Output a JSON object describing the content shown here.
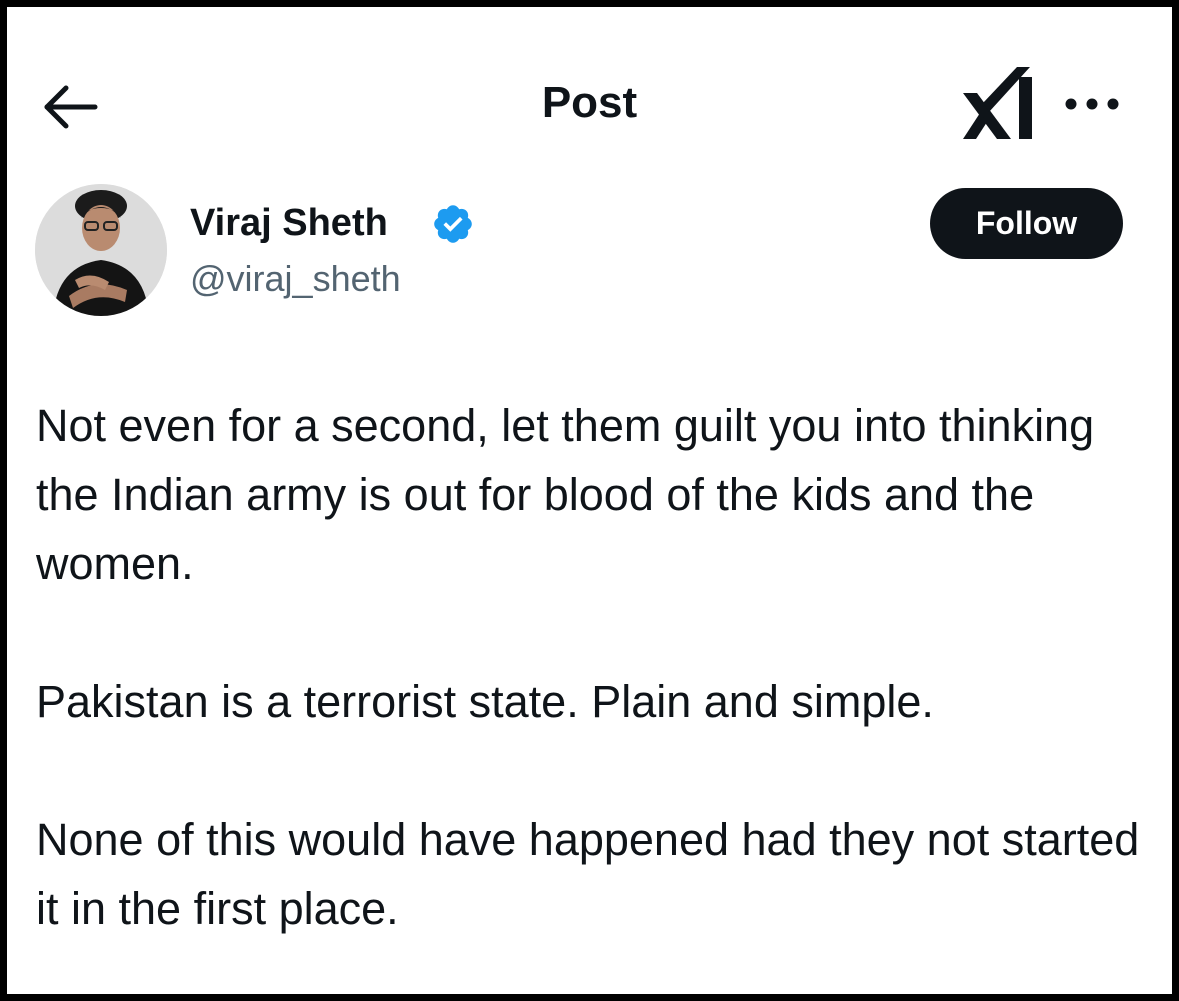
{
  "header": {
    "title": "Post",
    "back_icon": "arrow-left-icon",
    "grok_icon": "grok-icon",
    "more_icon": "more-horizontal-icon"
  },
  "author": {
    "display_name": "Viraj Sheth",
    "handle": "@viraj_sheth",
    "verified": true,
    "verified_color": "#1d9bf0"
  },
  "follow_button": {
    "label": "Follow"
  },
  "post": {
    "paragraphs": [
      "Not even for a second, let them guilt you into thinking the Indian army is out for blood of the kids and the women.",
      "Pakistan is a terrorist state. Plain and simple.",
      "None of this would have happened had they not started it in the first place."
    ]
  },
  "colors": {
    "text_primary": "#0f1419",
    "text_secondary": "#536471",
    "button_bg": "#0f1419",
    "button_text": "#ffffff"
  }
}
